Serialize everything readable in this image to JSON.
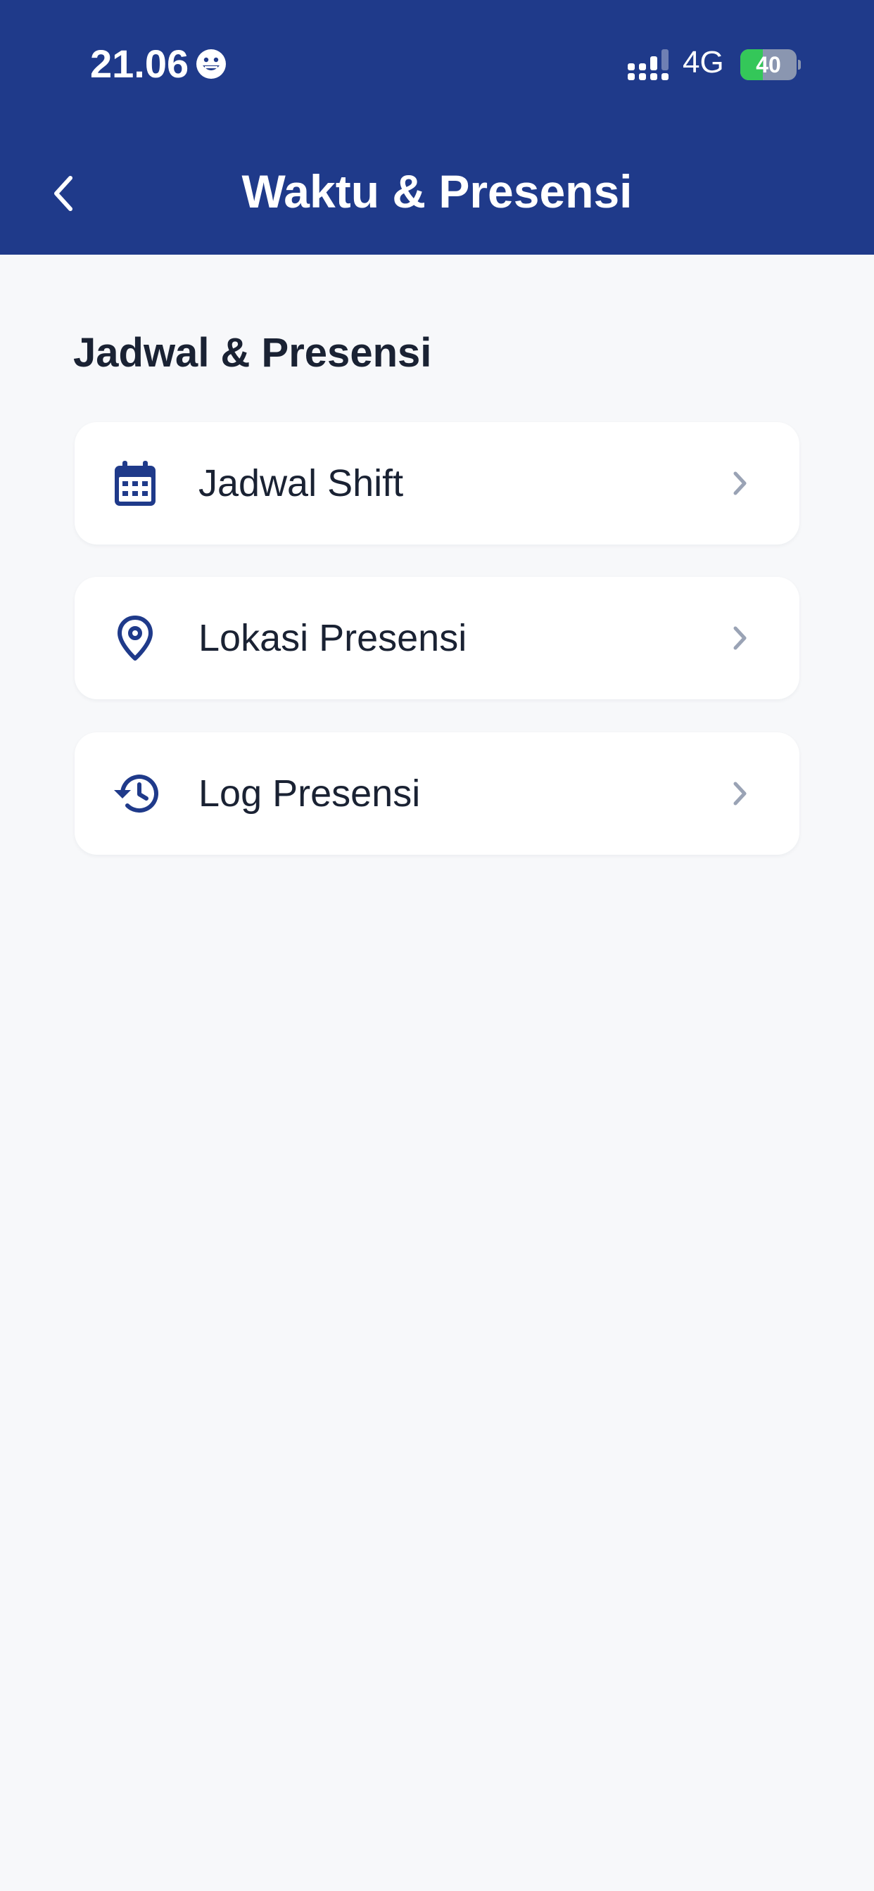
{
  "status_bar": {
    "time": "21.06",
    "network": "4G",
    "battery_level": "40",
    "battery_fraction": 0.4,
    "icons": [
      "emoji-face-icon",
      "signal-icon",
      "battery-icon"
    ]
  },
  "header": {
    "title": "Waktu & Presensi",
    "back_icon": "chevron-left-icon",
    "background_color": "#1f3a8a"
  },
  "section": {
    "title": "Jadwal & Presensi"
  },
  "menu": {
    "items": [
      {
        "label": "Jadwal Shift",
        "icon": "calendar-icon"
      },
      {
        "label": "Lokasi Presensi",
        "icon": "location-pin-icon"
      },
      {
        "label": "Log Presensi",
        "icon": "history-icon"
      }
    ],
    "chevron_icon": "chevron-right-icon"
  },
  "colors": {
    "accent": "#1f3a8a",
    "page_background": "#f7f8fa",
    "card_background": "#ffffff",
    "text_primary": "#1a2233",
    "chevron": "#9aa3b5",
    "battery_green": "#34c759"
  }
}
